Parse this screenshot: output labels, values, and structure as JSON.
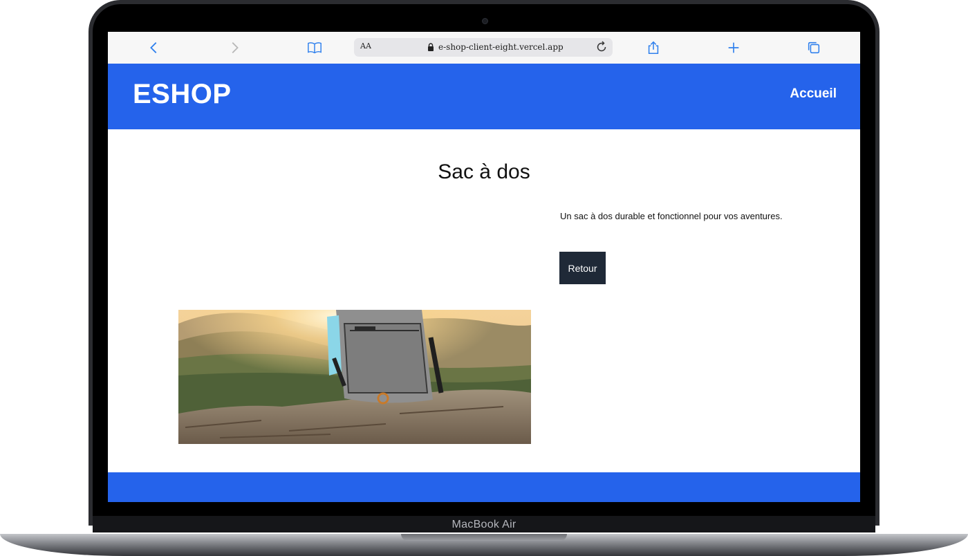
{
  "device": {
    "label": "MacBook Air"
  },
  "browser": {
    "text_size_label": "AA",
    "url": "e-shop-client-eight.vercel.app",
    "icons": [
      "chevron-left-icon",
      "chevron-right-icon",
      "book-icon",
      "lock-icon",
      "reload-icon",
      "share-icon",
      "plus-icon",
      "tabs-icon"
    ],
    "accent_color": "#2f80ed"
  },
  "site": {
    "logo": "ESHOP",
    "nav": {
      "home_label": "Accueil"
    },
    "brand_color": "#2563eb",
    "footer": {
      "text": ""
    }
  },
  "product": {
    "title": "Sac à dos",
    "description": "Un sac à dos durable et fonctionnel pour vos aventures.",
    "back_label": "Retour",
    "image_alt": "backpack-photo"
  }
}
